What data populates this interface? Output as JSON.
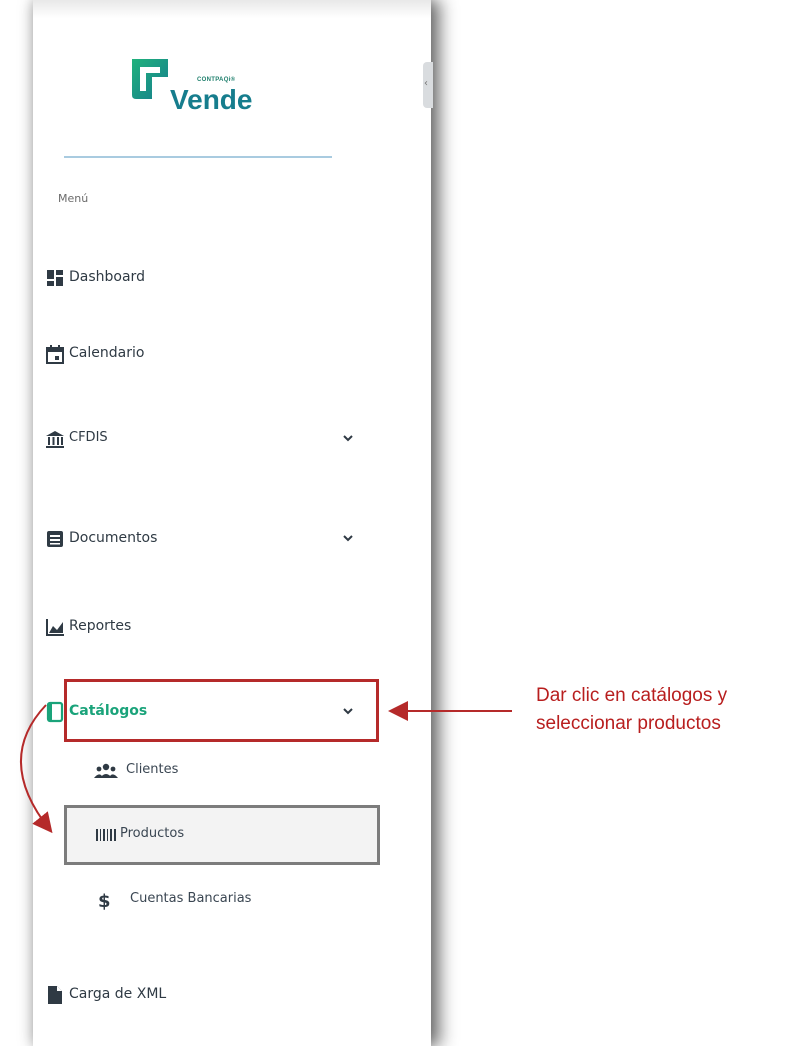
{
  "logo": {
    "brand_small": "CONTPAQi®",
    "brand_big": "Vende"
  },
  "menu_label": "Menú",
  "menu": [
    {
      "label": "Dashboard",
      "icon": "dashboard-icon"
    },
    {
      "label": "Calendario",
      "icon": "calendar-icon"
    },
    {
      "label": "CFDIS",
      "icon": "bank-icon",
      "expandable": true
    },
    {
      "label": "Documentos",
      "icon": "document-list-icon",
      "expandable": true
    },
    {
      "label": "Reportes",
      "icon": "chart-icon"
    },
    {
      "label": "Catálogos",
      "icon": "catalog-icon",
      "expandable": true,
      "active": true
    },
    {
      "label": "Carga de XML",
      "icon": "file-icon"
    }
  ],
  "submenu": [
    {
      "label": "Clientes",
      "icon": "users-icon"
    },
    {
      "label": "Productos",
      "icon": "barcode-icon",
      "selected": true
    },
    {
      "label": "Cuentas Bancarias",
      "icon": "dollar-icon"
    }
  ],
  "annotation": {
    "line1": "Dar clic en catálogos y",
    "line2": "seleccionar productos"
  },
  "colors": {
    "accent": "#1aa37a",
    "brand": "#167d8d",
    "annotation": "#b81e1e",
    "text": "#2f3a44"
  }
}
